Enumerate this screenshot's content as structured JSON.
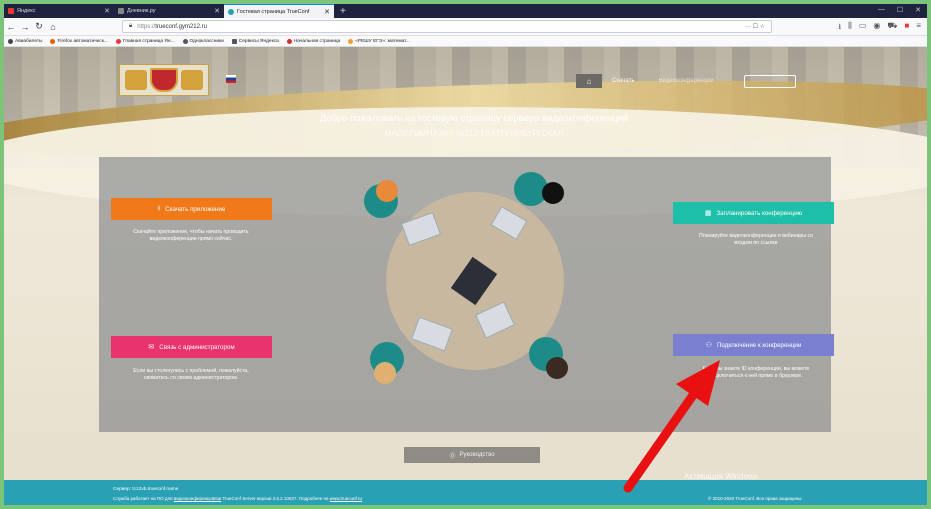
{
  "tabs": [
    {
      "title": "Яндекс",
      "color": "#e53935"
    },
    {
      "title": "Дневник.ру",
      "color": "#888888"
    },
    {
      "title": "Гостевая страница TrueConf",
      "color": "#2aa0b5"
    }
  ],
  "url": {
    "protocol": "https://",
    "host": "trueconf.gym212.ru",
    "extra": "··· ☐ ☆"
  },
  "bookmarks": [
    {
      "label": "Авиабилеты",
      "color": "#444"
    },
    {
      "label": "Firefox автоматическ...",
      "color": "#e66000"
    },
    {
      "label": "Главная страница Ян...",
      "color": "#e53935"
    },
    {
      "label": "Одноклассники",
      "color": "#555"
    },
    {
      "label": "Сервисы Яндекса",
      "color": "#555"
    },
    {
      "label": "Начальная страница",
      "color": "#d32f2f"
    },
    {
      "label": "«РЕШУ ЕГЭ»: математ...",
      "color": "#f0a030"
    }
  ],
  "site": {
    "nav_link": "Скачать",
    "nav_link2": "Видеоконференции",
    "welcome": "Добро пожаловать на гостевую страницу сервера видеоконференций",
    "subtitle": "МАОУ ГИМНАЗИЯ №212 ЕКАТЕРИНБУРГСКАЯ",
    "download_btn": "Скачать приложение",
    "download_desc": "Скачайте приложение, чтобы начать проводить видеоконференции прямо сейчас.",
    "schedule_btn": "Запланировать конференцию",
    "schedule_desc": "Планируйте видеоконференции и вебинары со входом по ссылке",
    "admin_btn": "Связь с администратором",
    "admin_desc": "Если вы столкнулись с проблемой, пожалуйста, свяжитесь со своим администратором.",
    "join_btn": "Подключение к конференции",
    "join_desc": "Если вы знаете ID конференции, вы можете подключиться к ней прямо в браузере.",
    "guide_btn": "Руководство",
    "watermark": "Активация Windows",
    "footer_server": "Сервер: tc12vb.trueconf.name",
    "footer_info_pre": "Служба работает на ПО для",
    "footer_info_link": "видеоконференцсвязи",
    "footer_info_mid": "TrueConf Server версии 4.5.2.10027. Подробнее на",
    "footer_info_link2": "www.trueconf.ru",
    "copyright": "© 2010-2020 TrueConf. Все права защищены"
  },
  "colors": {
    "download": "#f07a1a",
    "schedule": "#1ebfa8",
    "admin": "#e8336e",
    "join": "#7b7fd0",
    "footer": "#2aa0b5",
    "arrow": "#e81010"
  }
}
